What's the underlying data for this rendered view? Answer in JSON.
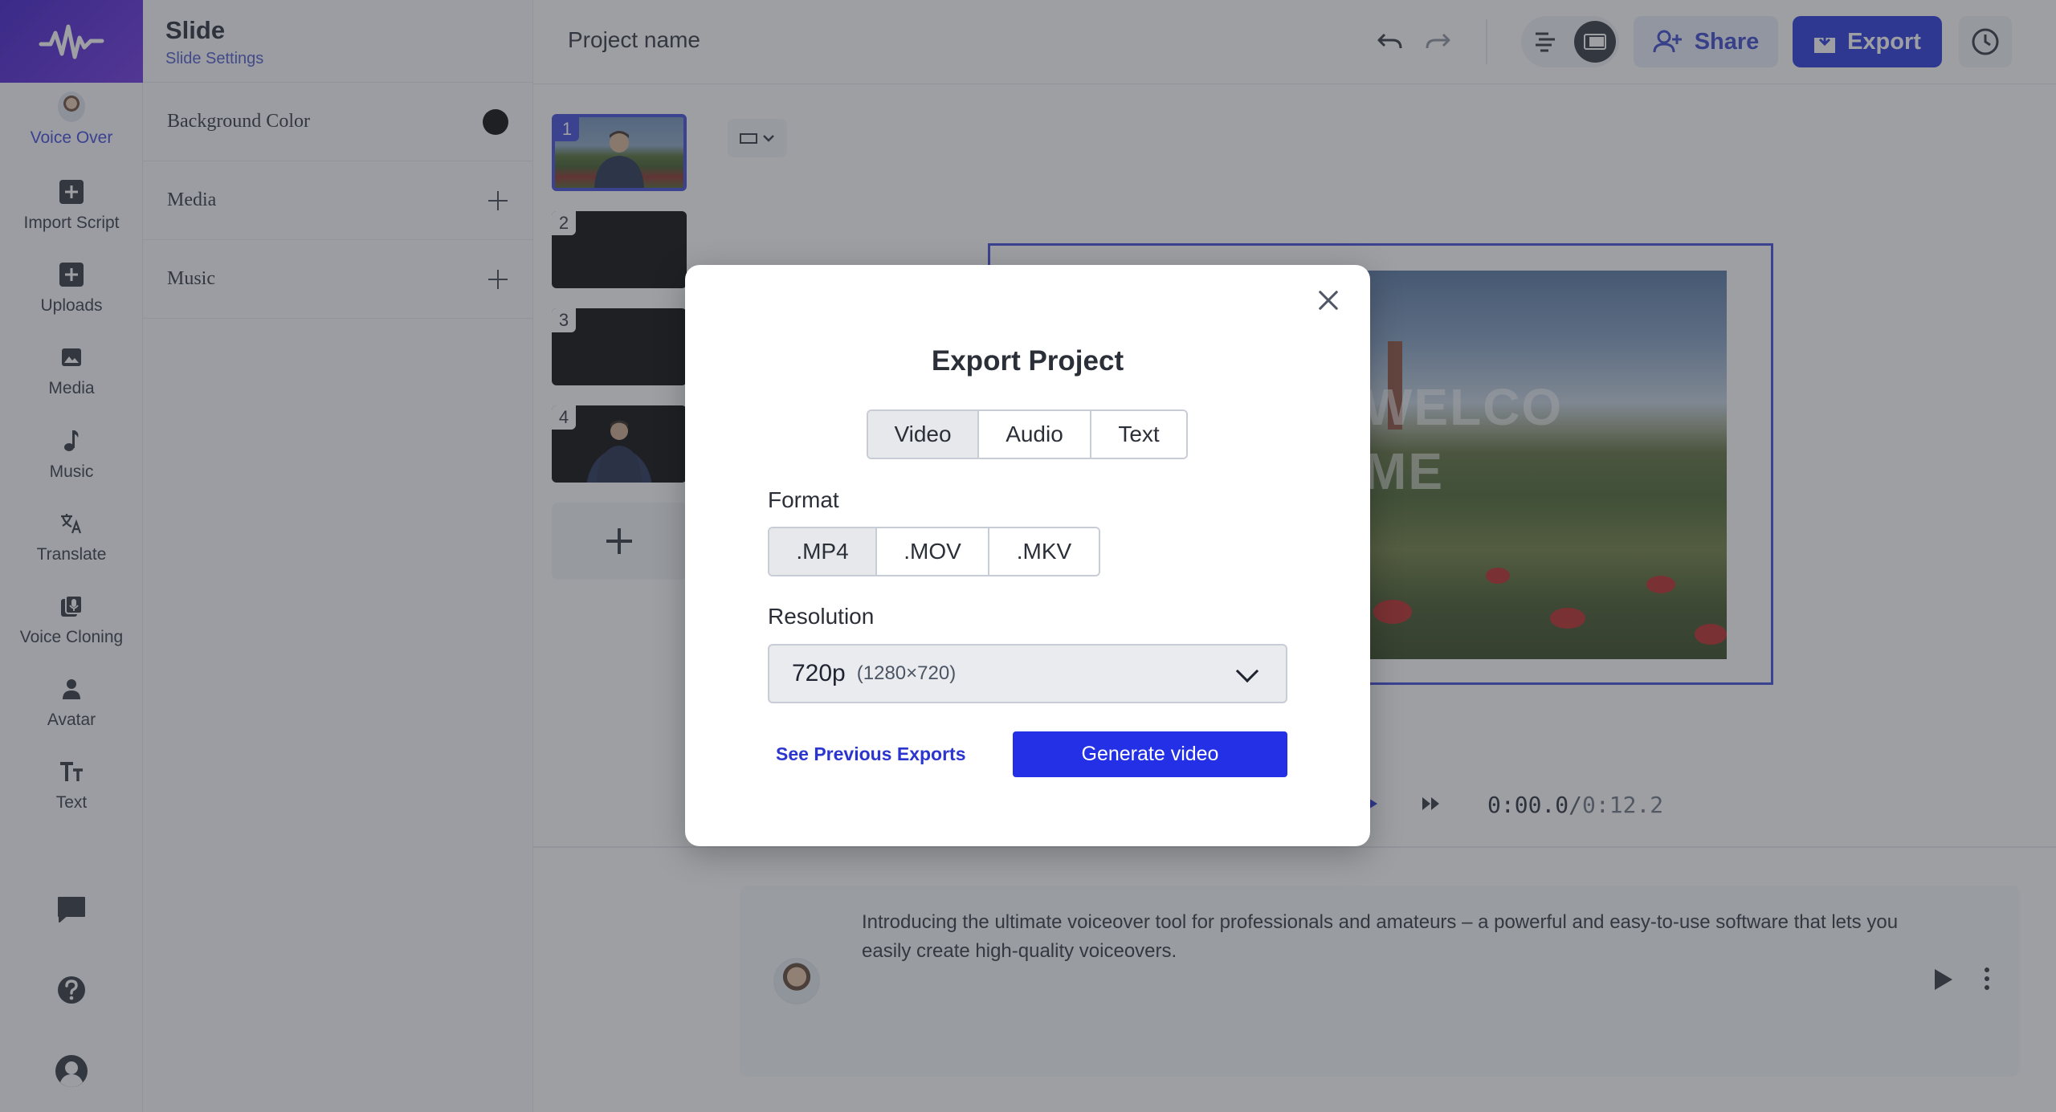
{
  "app": {
    "project_name": "Project name"
  },
  "rail": {
    "items": [
      {
        "label": "Voice Over",
        "icon": "voice-over-avatar-icon"
      },
      {
        "label": "Import Script",
        "icon": "plus-square-icon"
      },
      {
        "label": "Uploads",
        "icon": "plus-square-icon"
      },
      {
        "label": "Media",
        "icon": "image-icon"
      },
      {
        "label": "Music",
        "icon": "music-note-icon"
      },
      {
        "label": "Translate",
        "icon": "translate-icon"
      },
      {
        "label": "Voice Cloning",
        "icon": "voice-cloning-icon"
      },
      {
        "label": "Avatar",
        "icon": "person-icon"
      },
      {
        "label": "Text",
        "icon": "text-size-icon"
      }
    ],
    "bottom_icons": [
      "chat-icon",
      "help-icon",
      "account-icon"
    ]
  },
  "panel": {
    "title": "Slide",
    "subtitle": "Slide Settings",
    "rows": [
      {
        "label": "Background Color",
        "color": "#000000"
      },
      {
        "label": "Media"
      },
      {
        "label": "Music"
      }
    ]
  },
  "topbar": {
    "share_label": "Share",
    "export_label": "Export"
  },
  "slides": [
    {
      "number": "1"
    },
    {
      "number": "2"
    },
    {
      "number": "3"
    },
    {
      "number": "4"
    }
  ],
  "canvas": {
    "overlay_text_line1": "WELCO",
    "overlay_text_line2": "ME"
  },
  "player": {
    "current_time": "0:00.0",
    "separator": "/",
    "total_time": "0:12.2"
  },
  "script": {
    "text": "Introducing the ultimate voiceover tool for professionals and amateurs – a powerful and easy-to-use software that lets you easily create high-quality voiceovers."
  },
  "modal": {
    "title": "Export Project",
    "tabs": [
      {
        "label": "Video",
        "selected": true
      },
      {
        "label": "Audio",
        "selected": false
      },
      {
        "label": "Text",
        "selected": false
      }
    ],
    "format_label": "Format",
    "formats": [
      {
        "label": ".MP4",
        "selected": true
      },
      {
        "label": ".MOV",
        "selected": false
      },
      {
        "label": ".MKV",
        "selected": false
      }
    ],
    "resolution_label": "Resolution",
    "resolution_value": "720p",
    "resolution_detail": "(1280×720)",
    "previous_exports_label": "See Previous Exports",
    "generate_label": "Generate video"
  },
  "colors": {
    "accent": "#2330d9",
    "brand_gradient_start": "#3b16c9",
    "brand_gradient_end": "#6a2de0",
    "selected_slide_border": "#3b44d8"
  }
}
